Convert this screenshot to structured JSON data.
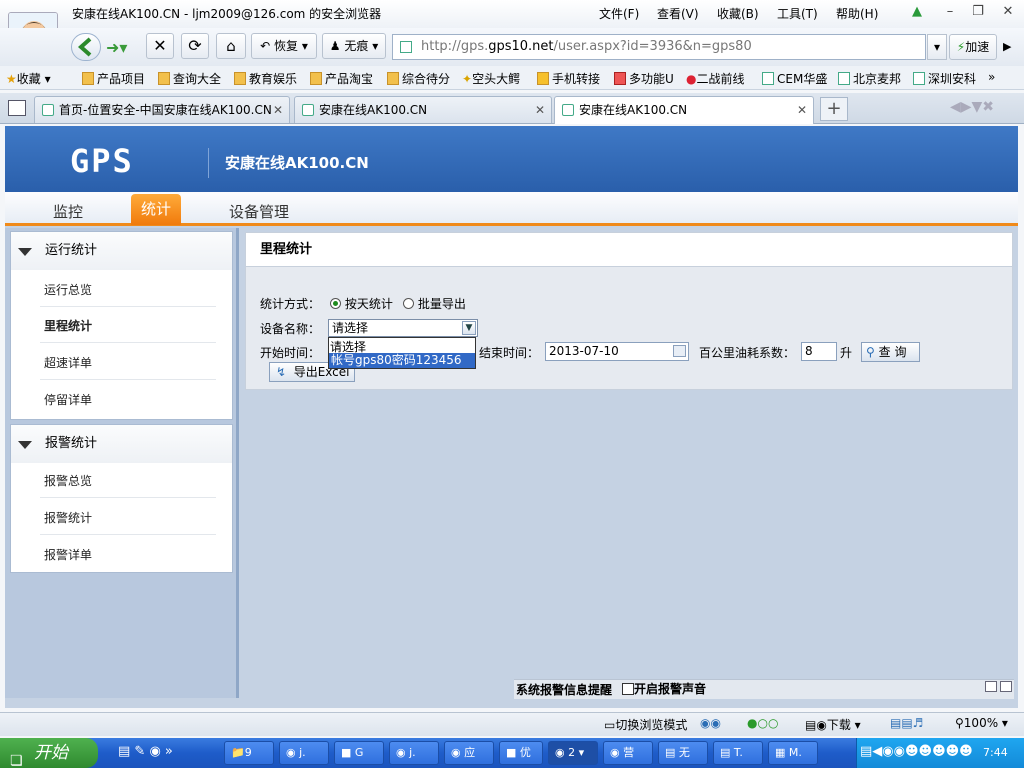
{
  "window": {
    "title": "安康在线AK100.CN - ljm2009@126.com 的安全浏览器",
    "menu": [
      "文件(F)",
      "查看(V)",
      "收藏(B)",
      "工具(T)",
      "帮助(H)"
    ]
  },
  "nav": {
    "restore_label": "恢复",
    "notrace_label": "无痕",
    "url_prefix": "http://gps.",
    "url_domain": "gps10.net",
    "url_suffix": "/user.aspx?id=3936&n=gps80",
    "speed_label": "加速"
  },
  "favorites": [
    "收藏",
    "产品项目",
    "查询大全",
    "教育娱乐",
    "产品淘宝",
    "综合待分",
    "空头大鳄",
    "手机转接",
    "多功能U",
    "二战前线",
    "CEM华盛",
    "北京麦邦",
    "深圳安科"
  ],
  "tabs": [
    {
      "label": "首页-位置安全-中国安康在线AK100.CN"
    },
    {
      "label": "安康在线AK100.CN"
    },
    {
      "label": "安康在线AK100.CN"
    }
  ],
  "header": {
    "logo": "GPS",
    "site_title": "安康在线AK100.CN"
  },
  "mainmenu": {
    "monitor": "监控",
    "stats": "统计",
    "devices": "设备管理"
  },
  "sidebar": {
    "group1": {
      "title": "运行统计",
      "items": [
        "运行总览",
        "里程统计",
        "超速详单",
        "停留详单"
      ]
    },
    "group2": {
      "title": "报警统计",
      "items": [
        "报警总览",
        "报警统计",
        "报警详单"
      ]
    }
  },
  "form": {
    "panel_title": "里程统计",
    "mode_label": "统计方式：",
    "mode_daily": "按天统计",
    "mode_batch": "批量导出",
    "device_label": "设备名称：",
    "device_selected": "请选择",
    "device_options": [
      "请选择",
      "帐号gps80密码123456"
    ],
    "start_label": "开始时间：",
    "end_label": "结束时间：",
    "end_value": "2013-07-10",
    "fuel_label": "百公里油耗系数：",
    "fuel_value": "8",
    "fuel_unit": "升",
    "query_label": "查 询",
    "export_label": "导出Excel"
  },
  "alarm": {
    "title": "系统报警信息提醒",
    "sound_label": "开启报警声音"
  },
  "statusbar": {
    "switch_mode": "切换浏览模式",
    "download": "下载",
    "zoom": "100%"
  },
  "taskbar": {
    "start": "开始",
    "tasks": [
      "9",
      "j.",
      "G",
      "j.",
      "应",
      "优",
      "2",
      "营",
      "无",
      "T.",
      "M."
    ],
    "clock": "7:44"
  }
}
